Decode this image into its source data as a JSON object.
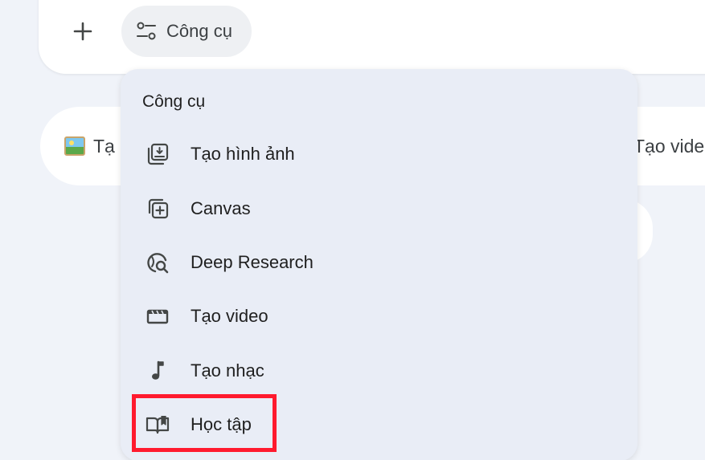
{
  "toolbar": {
    "add_icon": "plus-icon",
    "tools_icon": "sliders-icon",
    "tools_label": "Công cụ"
  },
  "chips": {
    "left_text": "Tạ",
    "right_text": "Tạo vide"
  },
  "menu": {
    "title": "Công cụ",
    "items": [
      {
        "label": "Tạo hình ảnh",
        "icon": "image-generate-icon"
      },
      {
        "label": "Canvas",
        "icon": "canvas-icon"
      },
      {
        "label": "Deep Research",
        "icon": "deep-research-icon"
      },
      {
        "label": "Tạo video",
        "icon": "video-icon"
      },
      {
        "label": "Tạo nhạc",
        "icon": "music-note-icon"
      },
      {
        "label": "Học tập",
        "icon": "book-icon"
      }
    ]
  },
  "colors": {
    "background": "#f0f3f9",
    "menu_background": "#e9edf6",
    "highlight": "#ff1a2e"
  }
}
